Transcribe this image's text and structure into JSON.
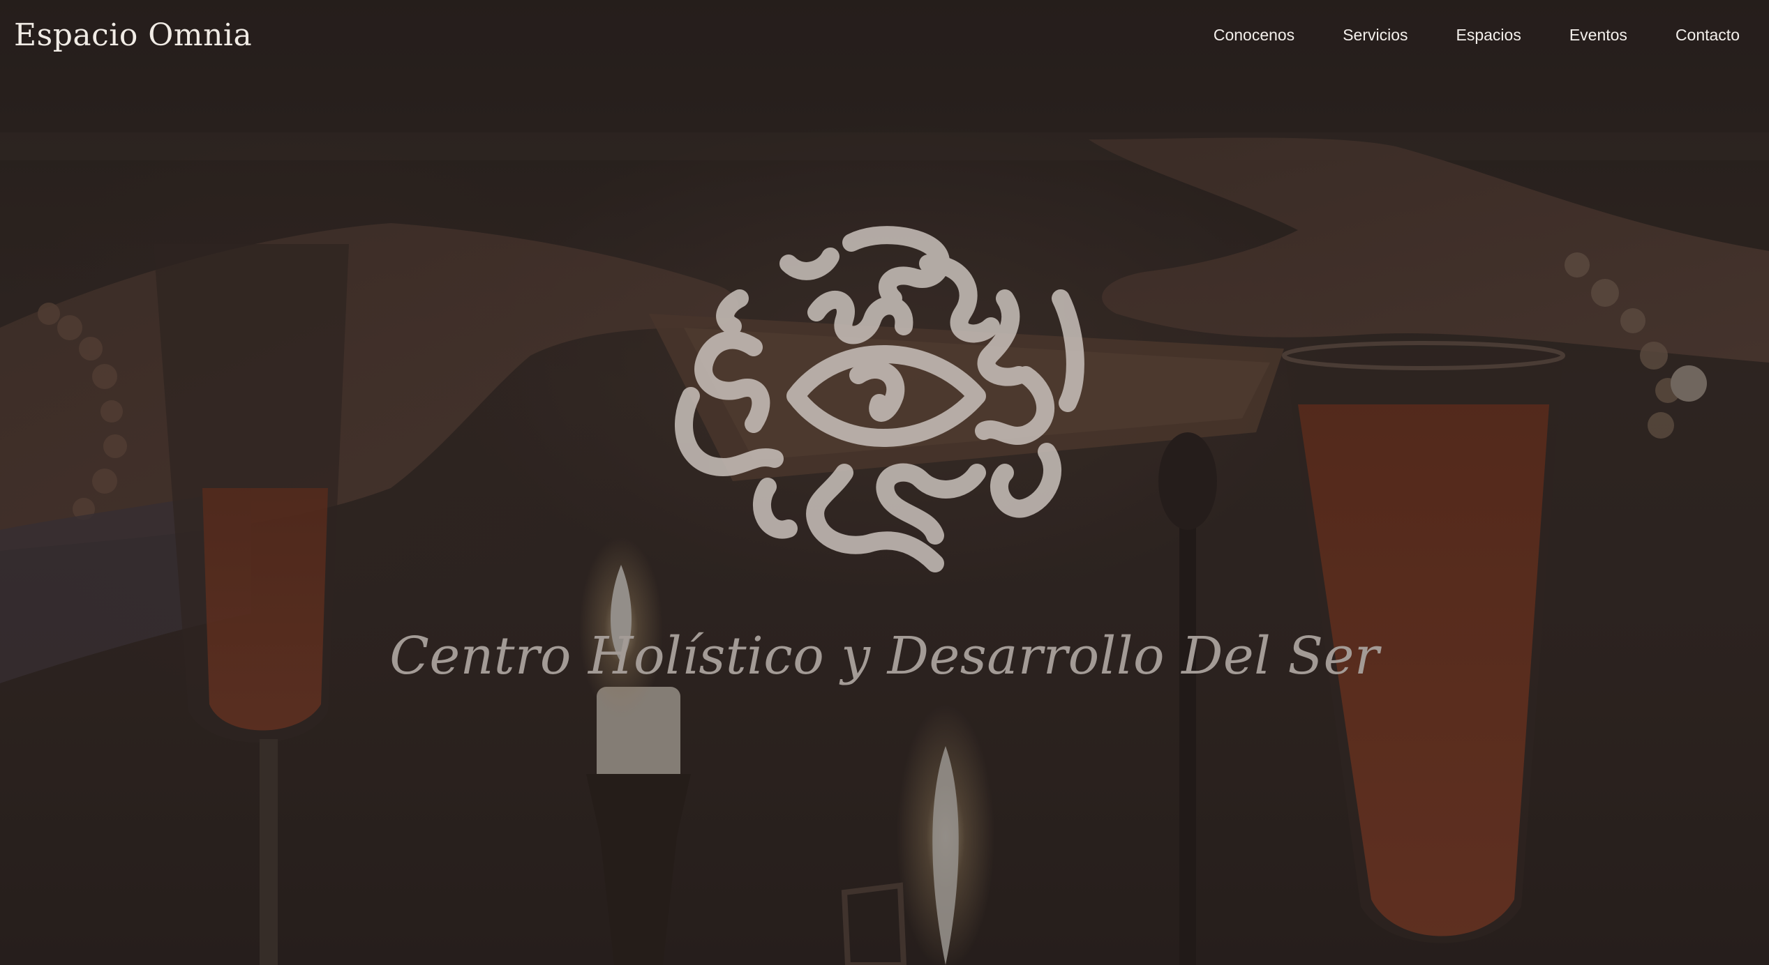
{
  "header": {
    "brand": "Espacio Omnia",
    "nav": [
      {
        "label": "Conocenos"
      },
      {
        "label": "Servicios"
      },
      {
        "label": "Espacios"
      },
      {
        "label": "Eventos"
      },
      {
        "label": "Contacto"
      }
    ]
  },
  "hero": {
    "tagline": "Centro Holístico y Desarrollo Del Ser",
    "emblem_icon": "swirl-eye-emblem",
    "background_image": "tarot-cards-candles-glasses-photo"
  },
  "colors": {
    "text_light": "#f1ece6",
    "tagline": "#a39b96",
    "emblem": "#c9c1bb",
    "background": "#2a221f"
  }
}
